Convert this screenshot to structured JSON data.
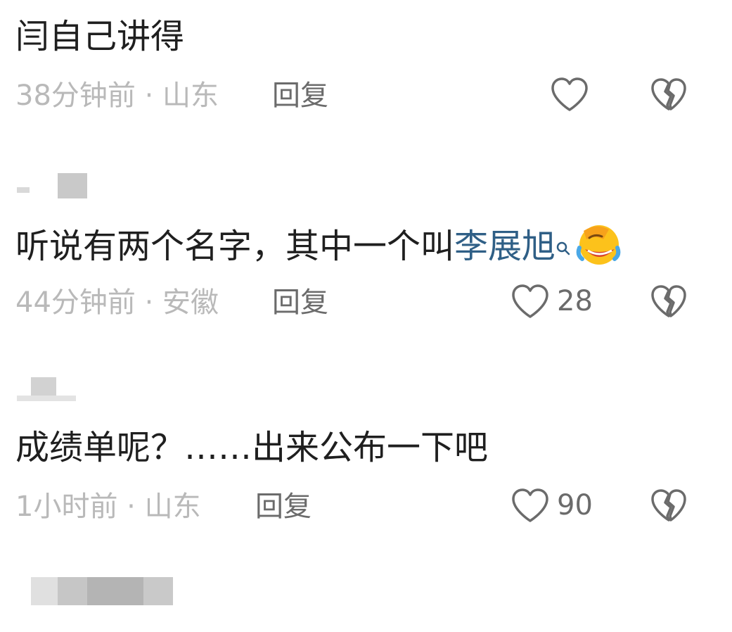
{
  "comments": [
    {
      "text": "闫自己讲得",
      "time_location": "38分钟前 · 山东",
      "reply_label": "回复",
      "like_count": ""
    },
    {
      "text_prefix": "听说有两个名字，其中一个叫",
      "link_name": "李展旭",
      "time_location": "44分钟前 · 安徽",
      "reply_label": "回复",
      "like_count": "28"
    },
    {
      "text": "成绩单呢？……出来公布一下吧",
      "time_location": "1小时前 · 山东",
      "reply_label": "回复",
      "like_count": "90"
    }
  ],
  "icons": {
    "like": "heart-outline-icon",
    "dislike": "broken-heart-icon",
    "search": "search-icon",
    "emoji": "laugh-cry-emoji"
  },
  "colors": {
    "text": "#1f1f1f",
    "meta": "#b9b9b9",
    "action": "#6b6b6b",
    "link": "#2f5f86"
  }
}
